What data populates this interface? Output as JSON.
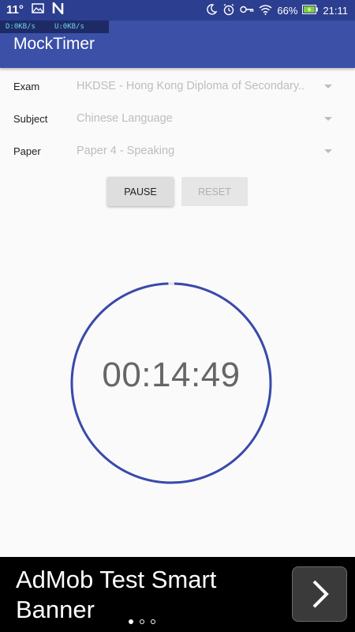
{
  "status_bar": {
    "temperature": "11°",
    "battery_percent": "66%",
    "time": "21:11",
    "download_speed": "D:0KB/s",
    "upload_speed": "U:0KB/s",
    "icons_left": [
      "image-icon",
      "n-notification-icon"
    ],
    "icons_right": [
      "moon-icon",
      "alarm-icon",
      "key-icon",
      "wifi-icon",
      "battery-icon"
    ]
  },
  "app": {
    "title": "MockTimer",
    "primary_color": "#3b50a6",
    "status_color": "#2c3e8f"
  },
  "form": {
    "exam": {
      "label": "Exam",
      "value": "HKDSE - Hong Kong Diploma of Secondary.."
    },
    "subject": {
      "label": "Subject",
      "value": "Chinese Language"
    },
    "paper": {
      "label": "Paper",
      "value": "Paper 4 - Speaking"
    }
  },
  "controls": {
    "pause_label": "PAUSE",
    "reset_label": "RESET",
    "reset_enabled": false
  },
  "timer": {
    "display": "00:14:49",
    "progress_fraction": 0.99,
    "ring_color": "#3949ab"
  },
  "ad_banner": {
    "text": "AdMob Test Smart Banner",
    "pages": 3,
    "active_page": 1
  }
}
